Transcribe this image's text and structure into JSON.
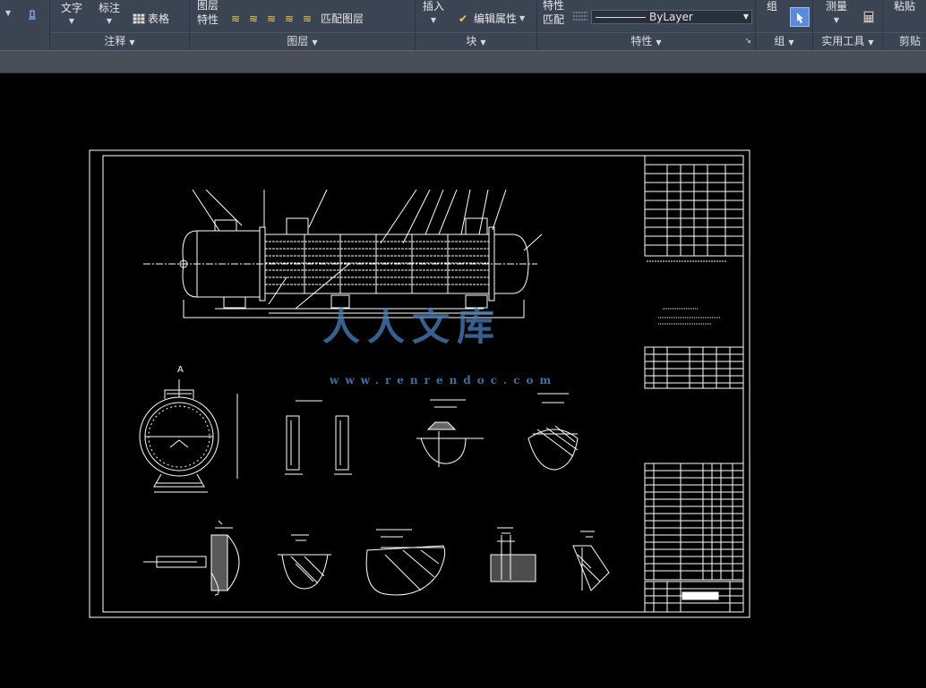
{
  "ribbon": {
    "annotate": {
      "text_label": "文字",
      "dim_label": "标注",
      "table_label": "表格",
      "panel_title": "注释"
    },
    "layers": {
      "props_label": "图层\n特性",
      "match_label": "匹配图层",
      "panel_title": "图层"
    },
    "block": {
      "insert_label": "插入",
      "edit_attr_label": "编辑属性",
      "panel_title": "块"
    },
    "properties": {
      "match_label": "特性\n匹配",
      "linetype_value": "ByLayer",
      "panel_title": "特性"
    },
    "groups": {
      "group_label": "组",
      "panel_title": "组"
    },
    "utilities": {
      "measure_label": "测量",
      "panel_title": "实用工具"
    },
    "clipboard": {
      "paste_label": "粘贴",
      "panel_title": "剪贴板"
    }
  },
  "drawing": {
    "section_label": "A",
    "watermark_text": "人人文库",
    "watermark_url": "www.renrendoc.com"
  }
}
